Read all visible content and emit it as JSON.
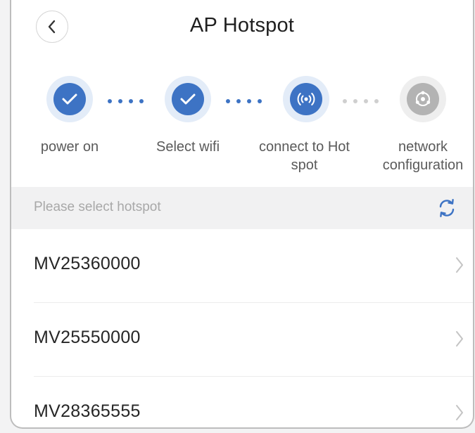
{
  "header": {
    "title": "AP Hotspot",
    "back_icon": "chevron-left-icon"
  },
  "steps": [
    {
      "label": "power on",
      "status": "done",
      "icon": "check-icon"
    },
    {
      "label": "Select wifi",
      "status": "done",
      "icon": "check-icon"
    },
    {
      "label": "connect to Hot spot",
      "status": "current",
      "icon": "hotspot-signal-icon"
    },
    {
      "label": "network configuration",
      "status": "pending",
      "icon": "network-config-icon"
    }
  ],
  "section": {
    "label": "Please select hotspot",
    "refresh_icon": "refresh-icon"
  },
  "hotspots": [
    {
      "ssid": "MV25360000"
    },
    {
      "ssid": "MV25550000"
    },
    {
      "ssid": "MV28365555"
    }
  ],
  "colors": {
    "accent": "#3d73c4",
    "inactive": "#b3b3b3",
    "section_bg": "#f1f1f2"
  }
}
